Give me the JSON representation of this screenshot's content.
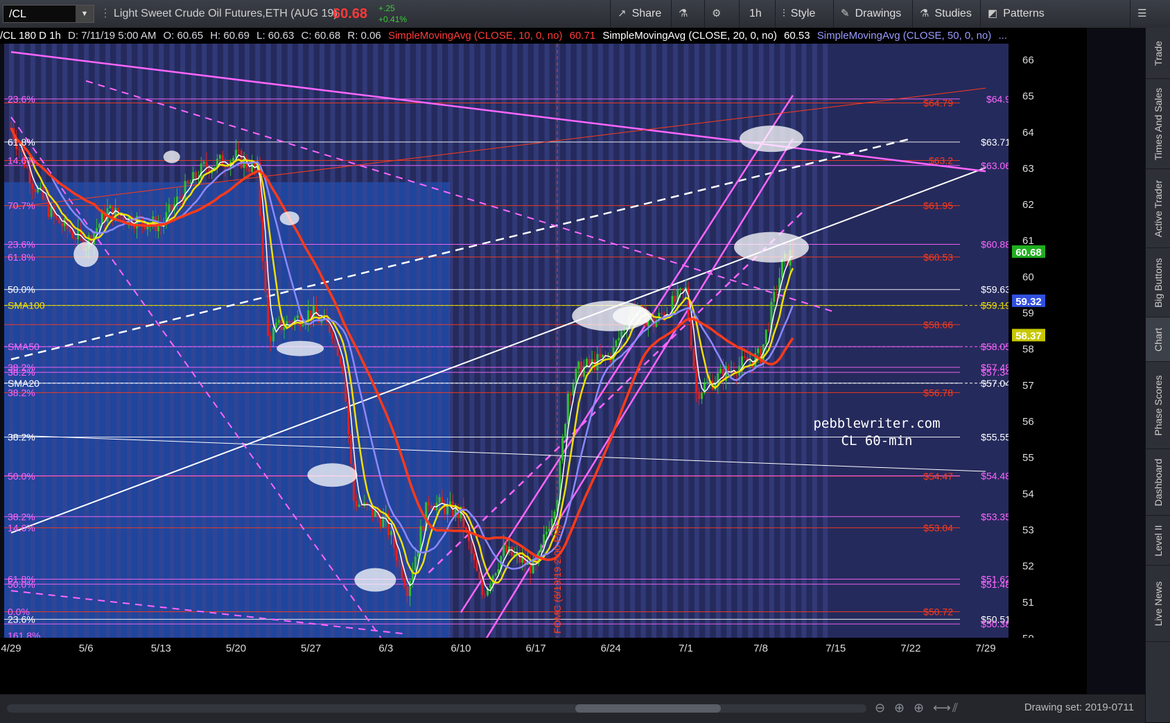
{
  "toolbar": {
    "symbol": "/CL",
    "title": "Light Sweet Crude Oil Futures,ETH (AUG 19)",
    "last_price": "60.68",
    "change": "+.25",
    "change_pct": "+0.41%",
    "share": "Share",
    "interval": "1h",
    "style": "Style",
    "drawings": "Drawings",
    "studies": "Studies",
    "patterns": "Patterns"
  },
  "infobar": {
    "header": "/CL 180 D 1h",
    "date": "D: 7/11/19 5:00 AM",
    "open": "O: 60.65",
    "high": "H: 60.69",
    "low": "L: 60.63",
    "close": "C: 60.68",
    "range": "R: 0.06",
    "sma10_label": "SimpleMovingAvg (CLOSE, 10, 0, no)",
    "sma10_value": "60.71",
    "sma20_label": "SimpleMovingAvg (CLOSE, 20, 0, no)",
    "sma20_value": "60.53",
    "sma50_label": "SimpleMovingAvg (CLOSE, 50, 0, no)",
    "sma50_value": "..."
  },
  "sidebar": {
    "tabs": [
      "Trade",
      "Times And Sales",
      "Active Trader",
      "Big Buttons",
      "Chart",
      "Phase Scores",
      "Dashboard",
      "Level II",
      "Live News"
    ],
    "active": "Chart"
  },
  "bottombar": {
    "drawing_set": "Drawing set: 2019-0711"
  },
  "watermark": {
    "line1": "pebblewriter.com",
    "line2": "CL 60-min"
  },
  "colors": {
    "sma10": "#ffffff",
    "sma20": "#f0e000",
    "sma50": "#8a8aff",
    "sma100": "#ff3a1a",
    "fib_pink": "#ff66ff",
    "fib_red": "#ff3a1a",
    "shade": "#1f4aa8",
    "up": "#2fbf2f",
    "down": "#e02020",
    "label_green": "#1fae1f",
    "label_blue": "#3050e0",
    "label_yellow": "#c8c800"
  },
  "chart_data": {
    "type": "candlestick",
    "title": "/CL 180 D 1h",
    "ylim": [
      50,
      66.2
    ],
    "y_ticks": [
      50,
      51,
      52,
      53,
      54,
      55,
      56,
      57,
      58,
      59,
      60,
      61,
      62,
      63,
      64,
      65,
      66
    ],
    "x_ticks": [
      "4/29",
      "5/6",
      "5/13",
      "5/20",
      "5/27",
      "6/3",
      "6/10",
      "6/17",
      "6/24",
      "7/1",
      "7/8",
      "7/15",
      "7/22",
      "7/29"
    ],
    "price_path": [
      {
        "x": "4/29",
        "y": 64.1
      },
      {
        "x": "5/1",
        "y": 62.6
      },
      {
        "x": "5/3",
        "y": 61.6
      },
      {
        "x": "5/6",
        "y": 60.9
      },
      {
        "x": "5/8",
        "y": 61.8
      },
      {
        "x": "5/10",
        "y": 61.6
      },
      {
        "x": "5/13",
        "y": 61.4
      },
      {
        "x": "5/15",
        "y": 62.3
      },
      {
        "x": "5/17",
        "y": 63.0
      },
      {
        "x": "5/20",
        "y": 63.3
      },
      {
        "x": "5/22",
        "y": 62.9
      },
      {
        "x": "5/23",
        "y": 58.3
      },
      {
        "x": "5/24",
        "y": 58.6
      },
      {
        "x": "5/27",
        "y": 59.0
      },
      {
        "x": "5/29",
        "y": 58.5
      },
      {
        "x": "5/30",
        "y": 57.5
      },
      {
        "x": "5/31",
        "y": 53.8
      },
      {
        "x": "6/3",
        "y": 53.2
      },
      {
        "x": "6/5",
        "y": 51.4
      },
      {
        "x": "6/7",
        "y": 53.8
      },
      {
        "x": "6/10",
        "y": 53.4
      },
      {
        "x": "6/12",
        "y": 51.2
      },
      {
        "x": "6/14",
        "y": 52.4
      },
      {
        "x": "6/17",
        "y": 51.9
      },
      {
        "x": "6/19",
        "y": 54.0
      },
      {
        "x": "6/20",
        "y": 56.8
      },
      {
        "x": "6/21",
        "y": 57.4
      },
      {
        "x": "6/24",
        "y": 57.8
      },
      {
        "x": "6/26",
        "y": 59.1
      },
      {
        "x": "6/28",
        "y": 58.7
      },
      {
        "x": "7/1",
        "y": 59.6
      },
      {
        "x": "7/2",
        "y": 56.8
      },
      {
        "x": "7/4",
        "y": 57.2
      },
      {
        "x": "7/5",
        "y": 57.4
      },
      {
        "x": "7/8",
        "y": 57.8
      },
      {
        "x": "7/10",
        "y": 60.3
      },
      {
        "x": "7/11",
        "y": 60.68
      }
    ],
    "series": [
      {
        "name": "SimpleMovingAvg (CLOSE, 10, 0, no)",
        "last": 60.71
      },
      {
        "name": "SimpleMovingAvg (CLOSE, 20, 0, no)",
        "last": 60.53
      },
      {
        "name": "SimpleMovingAvg (CLOSE, 50, 0, no)",
        "last": 59.32
      },
      {
        "name": "SMA100",
        "last": 58.37
      }
    ],
    "horizontal_levels": [
      {
        "y": 64.9,
        "label": "$64.9",
        "color": "#ff66ff"
      },
      {
        "y": 64.79,
        "label": "$64.79",
        "color": "#ff3a1a"
      },
      {
        "y": 63.71,
        "label": "$63.71",
        "color": "#ffffff"
      },
      {
        "y": 63.2,
        "label": "$63.2",
        "color": "#ff3a1a"
      },
      {
        "y": 63.06,
        "label": "$63.06",
        "color": "#ff66ff"
      },
      {
        "y": 61.95,
        "label": "$61.95",
        "color": "#ff3a1a"
      },
      {
        "y": 60.88,
        "label": "$60.88",
        "color": "#ff66ff"
      },
      {
        "y": 60.53,
        "label": "$60.53",
        "color": "#ff3a1a"
      },
      {
        "y": 59.63,
        "label": "$59.63",
        "color": "#ffffff"
      },
      {
        "y": 59.19,
        "label": "$59.19",
        "color": "#f0e000"
      },
      {
        "y": 58.66,
        "label": "$58.66",
        "color": "#ff3a1a"
      },
      {
        "y": 58.05,
        "label": "$58.05",
        "color": "#ff66ff"
      },
      {
        "y": 57.48,
        "label": "$57.48",
        "color": "#ff66ff"
      },
      {
        "y": 57.34,
        "label": "$57.34",
        "color": "#ff66ff"
      },
      {
        "y": 57.04,
        "label": "$57.04",
        "color": "#ffffff"
      },
      {
        "y": 56.78,
        "label": "$56.78",
        "color": "#ff3a1a"
      },
      {
        "y": 55.55,
        "label": "$55.55",
        "color": "#ffffff"
      },
      {
        "y": 54.47,
        "label": "$54.47",
        "color": "#ff3a1a"
      },
      {
        "y": 54.48,
        "label": "$54.48",
        "color": "#ff66ff"
      },
      {
        "y": 53.35,
        "label": "$53.35",
        "color": "#ff66ff"
      },
      {
        "y": 53.04,
        "label": "$53.04",
        "color": "#ff3a1a"
      },
      {
        "y": 51.62,
        "label": "$51.62",
        "color": "#ff66ff"
      },
      {
        "y": 51.48,
        "label": "$51.48",
        "color": "#ff66ff"
      },
      {
        "y": 50.72,
        "label": "$50.72",
        "color": "#ff3a1a"
      },
      {
        "y": 50.51,
        "label": "$50.51",
        "color": "#ffffff"
      },
      {
        "y": 50.38,
        "label": "$50.38",
        "color": "#ff66ff"
      }
    ],
    "fib_labels": [
      {
        "y": 64.9,
        "label": "23.6%",
        "color": "#ff66ff"
      },
      {
        "y": 63.71,
        "label": "61.8%",
        "color": "#ffffff"
      },
      {
        "y": 63.2,
        "label": "14.6%",
        "color": "#ff66ff"
      },
      {
        "y": 61.95,
        "label": "70.7%",
        "color": "#ff66ff"
      },
      {
        "y": 60.88,
        "label": "23.6%",
        "color": "#ff66ff"
      },
      {
        "y": 60.53,
        "label": "61.8%",
        "color": "#ff66ff"
      },
      {
        "y": 59.63,
        "label": "50.0%",
        "color": "#ffffff"
      },
      {
        "y": 57.48,
        "label": "38.2%",
        "color": "#ff66ff"
      },
      {
        "y": 57.34,
        "label": "38.2%",
        "color": "#ff66ff"
      },
      {
        "y": 56.78,
        "label": "38.2%",
        "color": "#ff66ff"
      },
      {
        "y": 55.55,
        "label": "38.2%",
        "color": "#ffffff"
      },
      {
        "y": 54.47,
        "label": "50.0%",
        "color": "#ff66ff"
      },
      {
        "y": 53.35,
        "label": "38.2%",
        "color": "#ff66ff"
      },
      {
        "y": 53.04,
        "label": "14.6%",
        "color": "#ff66ff"
      },
      {
        "y": 51.62,
        "label": "61.8%",
        "color": "#ff66ff"
      },
      {
        "y": 51.48,
        "label": "50.0%",
        "color": "#ff66ff"
      },
      {
        "y": 50.72,
        "label": "0.0%",
        "color": "#ff66ff"
      },
      {
        "y": 50.51,
        "label": "23.6%",
        "color": "#ffffff"
      },
      {
        "y": 50.06,
        "label": "161.8%",
        "color": "#ff66ff"
      }
    ],
    "sma_labels": [
      {
        "y": 59.19,
        "label": "SMA100",
        "color": "#f0e000"
      },
      {
        "y": 58.05,
        "label": "SMA50",
        "color": "#ff66ff"
      },
      {
        "y": 57.04,
        "label": "SMA20",
        "color": "#ffffff"
      }
    ],
    "price_tags": [
      {
        "y": 60.68,
        "label": "60.68",
        "color": "#1fae1f"
      },
      {
        "y": 59.32,
        "label": "59.32",
        "color": "#3050e0"
      },
      {
        "y": 58.37,
        "label": "58.37",
        "color": "#c8c800"
      }
    ],
    "event_marker": {
      "x": "6/19",
      "label": "FOMC (6/19/19 2:00 PM)"
    }
  }
}
